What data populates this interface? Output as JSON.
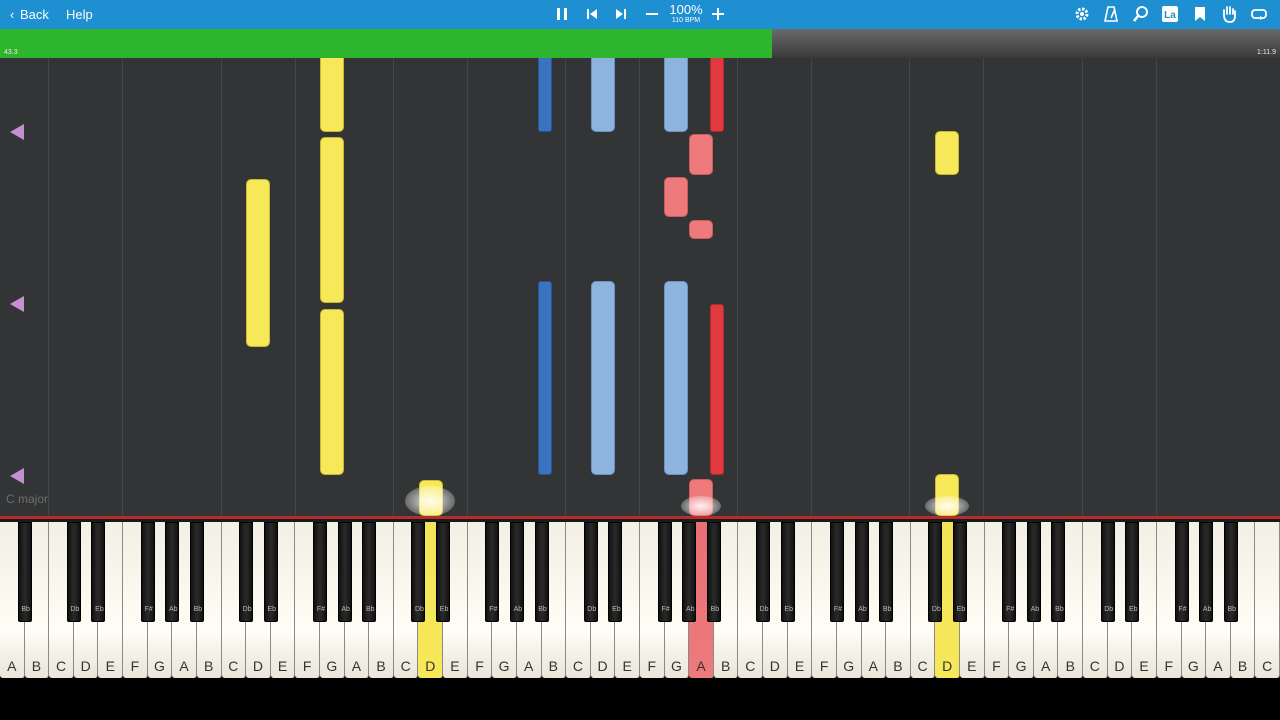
{
  "toolbar": {
    "back_label": "Back",
    "help_label": "Help",
    "speed_percent": "100%",
    "speed_bpm": "110 BPM",
    "icons": [
      "pause-icon",
      "skip-back-icon",
      "skip-forward-icon",
      "minus-icon",
      "plus-icon",
      "gear-icon",
      "metronome-icon",
      "magnifier-icon",
      "label-icon",
      "bookmark-icon",
      "hand-icon",
      "loop-icon"
    ],
    "label_icon_text": "La"
  },
  "progress": {
    "elapsed": "43.3",
    "total": "1:11.9",
    "fraction": 0.603,
    "fill_color": "#2db52d"
  },
  "roll": {
    "key_signature": "C major",
    "colors": {
      "right_hand": "#f7e859",
      "left_hand_dark": "#3a73c0",
      "left_hand_light": "#8fb3df",
      "accent_red": "#e0393e",
      "accent_pink": "#ee7a7c"
    }
  },
  "keyboard": {
    "white_keys": [
      "A",
      "B",
      "C",
      "D",
      "E",
      "F",
      "G",
      "A",
      "B",
      "C",
      "D",
      "E",
      "F",
      "G",
      "A",
      "B",
      "C",
      "D",
      "E",
      "F",
      "G",
      "A",
      "B",
      "C",
      "D",
      "E",
      "F",
      "G",
      "A",
      "B",
      "C",
      "D",
      "E",
      "F",
      "G",
      "A",
      "B",
      "C",
      "D",
      "E",
      "F",
      "G",
      "A",
      "B",
      "C",
      "D",
      "E",
      "F",
      "G",
      "A",
      "B",
      "C"
    ],
    "black_keys": [
      "Bb",
      "Db",
      "Eb",
      "F#",
      "Ab",
      "Bb",
      "Db",
      "Eb",
      "F#",
      "Ab",
      "Bb",
      "Db",
      "Eb",
      "F#",
      "Ab",
      "Bb",
      "Db",
      "Eb",
      "F#",
      "Ab",
      "Bb",
      "Db",
      "Eb",
      "F#",
      "Ab",
      "Bb",
      "Db",
      "Eb",
      "F#",
      "Ab",
      "Bb",
      "Db",
      "Eb",
      "F#",
      "Ab",
      "Bb"
    ],
    "pressed": [
      {
        "key": "D",
        "octave_index": 4,
        "color": "yellow"
      },
      {
        "key": "A",
        "octave_index": 4,
        "color": "red"
      },
      {
        "key": "D",
        "octave_index": 6,
        "color": "yellow"
      }
    ]
  }
}
